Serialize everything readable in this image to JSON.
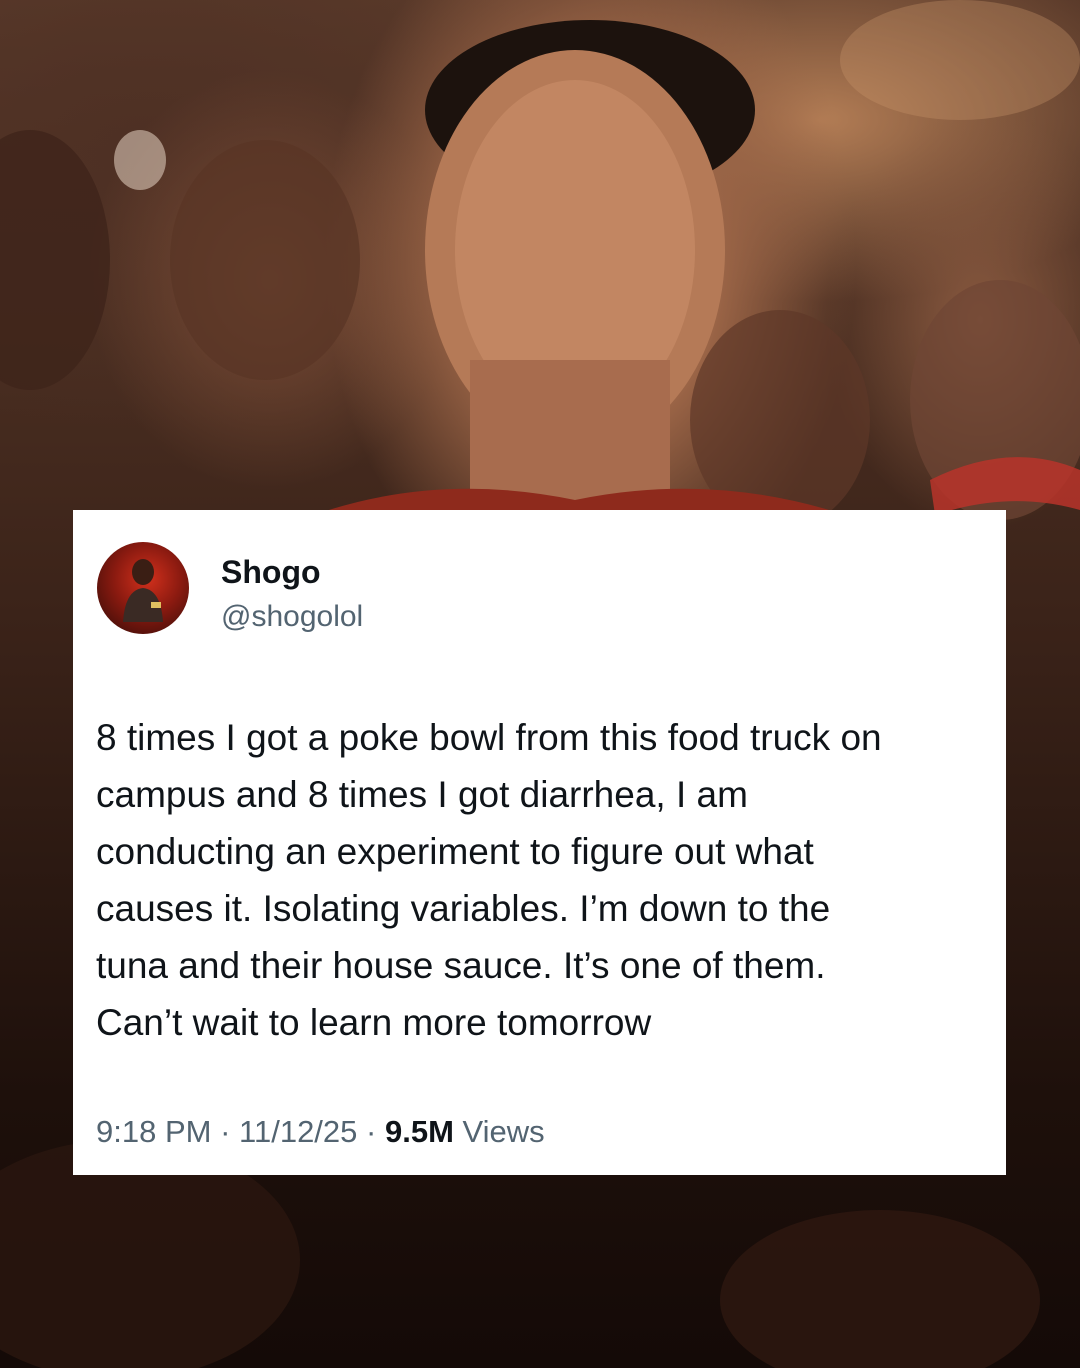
{
  "tweet": {
    "author": {
      "display_name": "Shogo",
      "handle": "@shogolol"
    },
    "text": "8 times I got a poke bowl from this food truck on\ncampus and 8 times I got diarrhea, I am\nconducting an experiment to figure out what\ncauses it. Isolating variables. I’m down to the\ntuna and their house sauce. It’s one of them.\nCan’t wait to learn more tomorrow",
    "time": "9:18 PM",
    "separator": "·",
    "date": "11/12/25",
    "views_count": "9.5M",
    "views_label": "Views"
  },
  "colors": {
    "card_background": "#ffffff",
    "primary_text": "#0f1419",
    "secondary_text": "#536471"
  }
}
